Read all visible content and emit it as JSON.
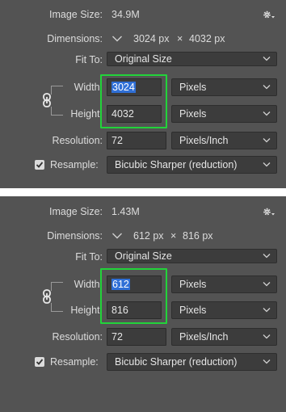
{
  "panels": [
    {
      "image_size_label": "Image Size:",
      "image_size_value": "34.9M",
      "dimensions_label": "Dimensions:",
      "dim_width": "3024 px",
      "dim_times": "×",
      "dim_height": "4032 px",
      "fit_to_label": "Fit To:",
      "fit_to_value": "Original Size",
      "width_label": "Width:",
      "width_value": "3024",
      "width_unit": "Pixels",
      "height_label": "Height:",
      "height_value": "4032",
      "height_unit": "Pixels",
      "resolution_label": "Resolution:",
      "resolution_value": "72",
      "resolution_unit": "Pixels/Inch",
      "resample_label": "Resample:",
      "resample_value": "Bicubic Sharper (reduction)"
    },
    {
      "image_size_label": "Image Size:",
      "image_size_value": "1.43M",
      "dimensions_label": "Dimensions:",
      "dim_width": "612 px",
      "dim_times": "×",
      "dim_height": "816 px",
      "fit_to_label": "Fit To:",
      "fit_to_value": "Original Size",
      "width_label": "Width:",
      "width_value": "612",
      "width_unit": "Pixels",
      "height_label": "Height:",
      "height_value": "816",
      "height_unit": "Pixels",
      "resolution_label": "Resolution:",
      "resolution_value": "72",
      "resolution_unit": "Pixels/Inch",
      "resample_label": "Resample:",
      "resample_value": "Bicubic Sharper (reduction)"
    }
  ],
  "colors": {
    "panel_bg": "#535353",
    "field_bg": "#3c3c3c",
    "highlight": "#22d33a",
    "selection": "#2f6fd6"
  },
  "icons": [
    "gear-icon",
    "chevron-down-icon",
    "chain-link-icon",
    "checkmark-icon"
  ]
}
